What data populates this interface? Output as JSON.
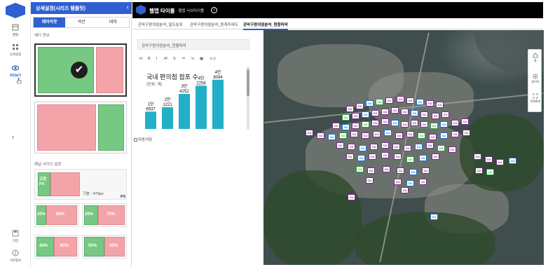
{
  "rail": {
    "items": [
      {
        "label": "웹맵"
      },
      {
        "label": "상세설정"
      },
      {
        "label": "미리보기"
      },
      {
        "label": "저장"
      },
      {
        "label": "기본정보"
      }
    ],
    "expand_arrow": "›"
  },
  "panel": {
    "title": "상세설정(시리즈 템플릿)",
    "collapse": "‹",
    "tabs": [
      {
        "label": "레이아웃",
        "active": true
      },
      {
        "label": "색션",
        "active": false
      },
      {
        "label": "테마",
        "active": false
      }
    ],
    "header_info_label": "헤더 정보",
    "series_size_label": "패널 사이즈 설정",
    "fixed": {
      "label": "고정",
      "unit_label": "PX",
      "base": "기본 : 470px",
      "unit": "PX"
    },
    "splits": [
      {
        "left": "20%",
        "right": "80%"
      },
      {
        "left": "30%",
        "right": "70%"
      },
      {
        "left": "40%",
        "right": "60%"
      },
      {
        "left": "50%",
        "right": "50%"
      }
    ]
  },
  "topbar": {
    "title": "웹맵 타이틀",
    "subtitle": "· 웹맵 서브타이틀",
    "info": "i"
  },
  "view_tabs": [
    {
      "label": "관악구편의점분석_밀도분포",
      "active": false
    },
    {
      "label": "관악구편의점분석_동계주파도",
      "active": false
    },
    {
      "label": "관악구편의점분석_현황파악",
      "active": true
    }
  ],
  "widget": {
    "title_input": "관악구편의점분석_현황파악",
    "toolbar": [
      "H",
      "B",
      "I",
      "A²",
      "S",
      "≔",
      "⁝≡",
      "▦",
      "⊂⊃"
    ],
    "auto_apply": "자동저장"
  },
  "chart_data": {
    "type": "bar",
    "title": "국내 편의점 점포 수",
    "unit": "(단위: 개)",
    "categories": [
      "1",
      "2",
      "3",
      "4",
      "5"
    ],
    "values": [
      16937,
      21221,
      34252,
      42258,
      48094
    ],
    "labels": [
      [
        "1만",
        "6937"
      ],
      [
        "2만",
        "1221"
      ],
      [
        "3만",
        "4252"
      ],
      [
        "4만",
        "2258"
      ],
      [
        "4만",
        "8094"
      ]
    ],
    "ylim": [
      0,
      50000
    ],
    "bar_color": "#22b0c6"
  },
  "map": {
    "marker_label": "CU",
    "tools": [
      {
        "label": "홈"
      },
      {
        "label": "레이어"
      },
      {
        "label": "전체화면"
      }
    ]
  },
  "colors": {
    "brand": "#2f5fd0",
    "layout_green": "#75c983",
    "layout_pink": "#f4a4a9"
  }
}
